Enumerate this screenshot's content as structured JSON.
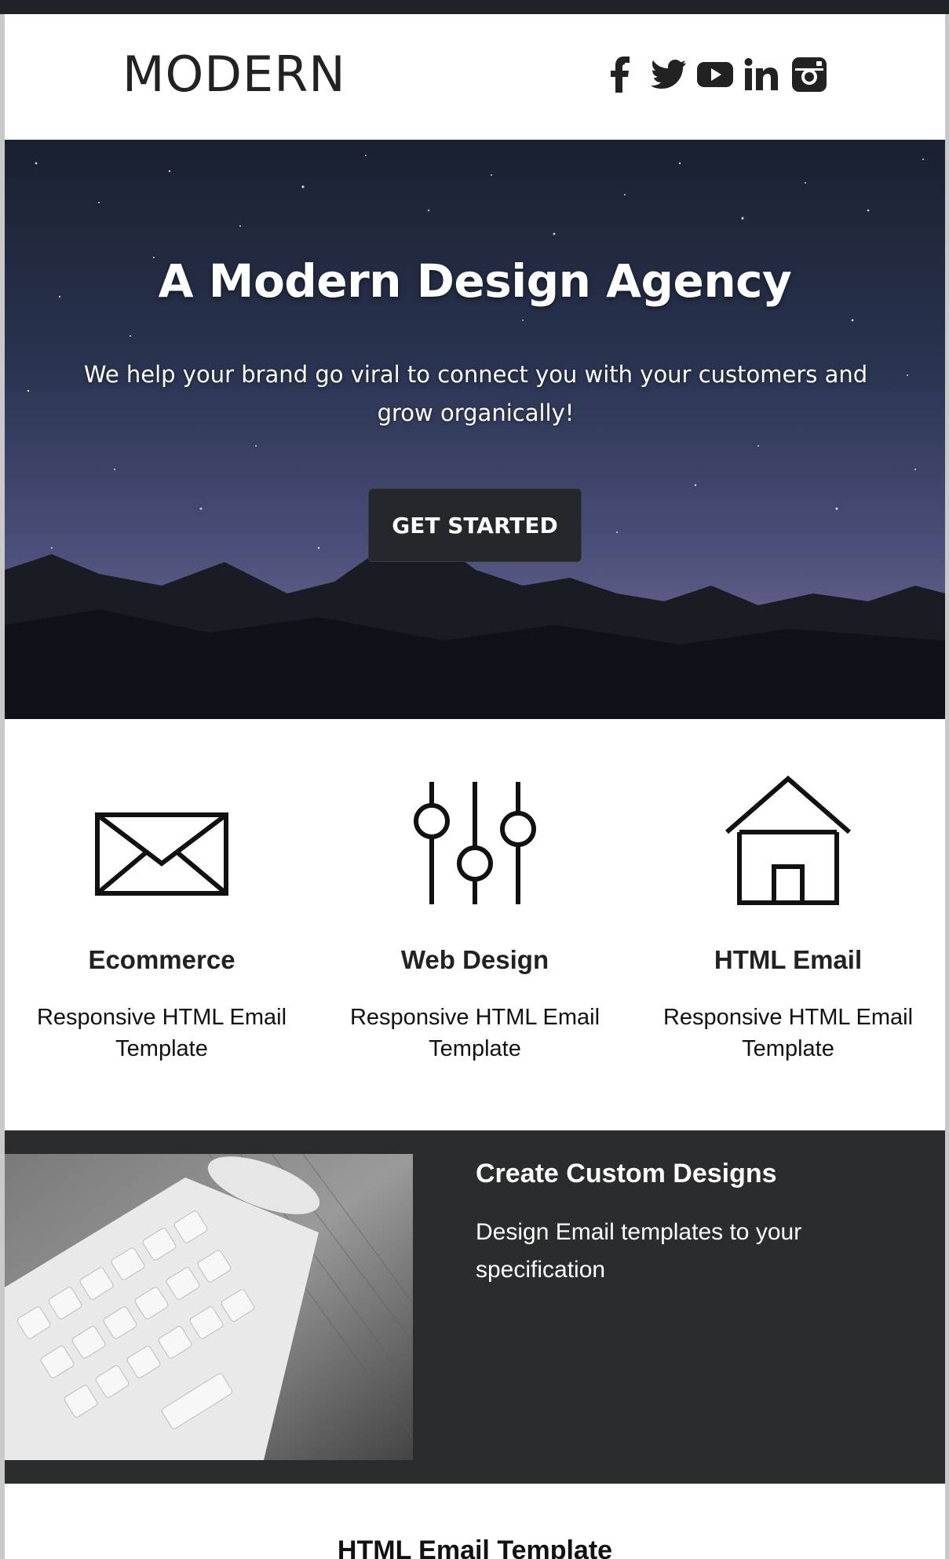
{
  "header": {
    "logo": "MODERN",
    "social_icons": [
      "facebook-icon",
      "twitter-icon",
      "youtube-icon",
      "linkedin-icon",
      "instagram-icon"
    ]
  },
  "hero": {
    "title": "A Modern Design Agency",
    "subtitle": "We help your brand go viral to connect you with your customers and grow organically!",
    "button_label": "GET STARTED"
  },
  "features": [
    {
      "icon": "envelope-icon",
      "title": "Ecommerce",
      "description": "Responsive HTML Email Template"
    },
    {
      "icon": "sliders-icon",
      "title": "Web Design",
      "description": "Responsive HTML Email Template"
    },
    {
      "icon": "house-icon",
      "title": "HTML Email",
      "description": "Responsive HTML Email Template"
    }
  ],
  "band": {
    "title": "Create Custom Designs",
    "text": "Design Email templates to your specification"
  },
  "bottom": {
    "title": "HTML Email Template"
  },
  "colors": {
    "topbar": "#1f2326",
    "button_bg": "#25282b",
    "band_bg": "#2b2c2e",
    "text_dark": "#222222",
    "white": "#ffffff"
  }
}
